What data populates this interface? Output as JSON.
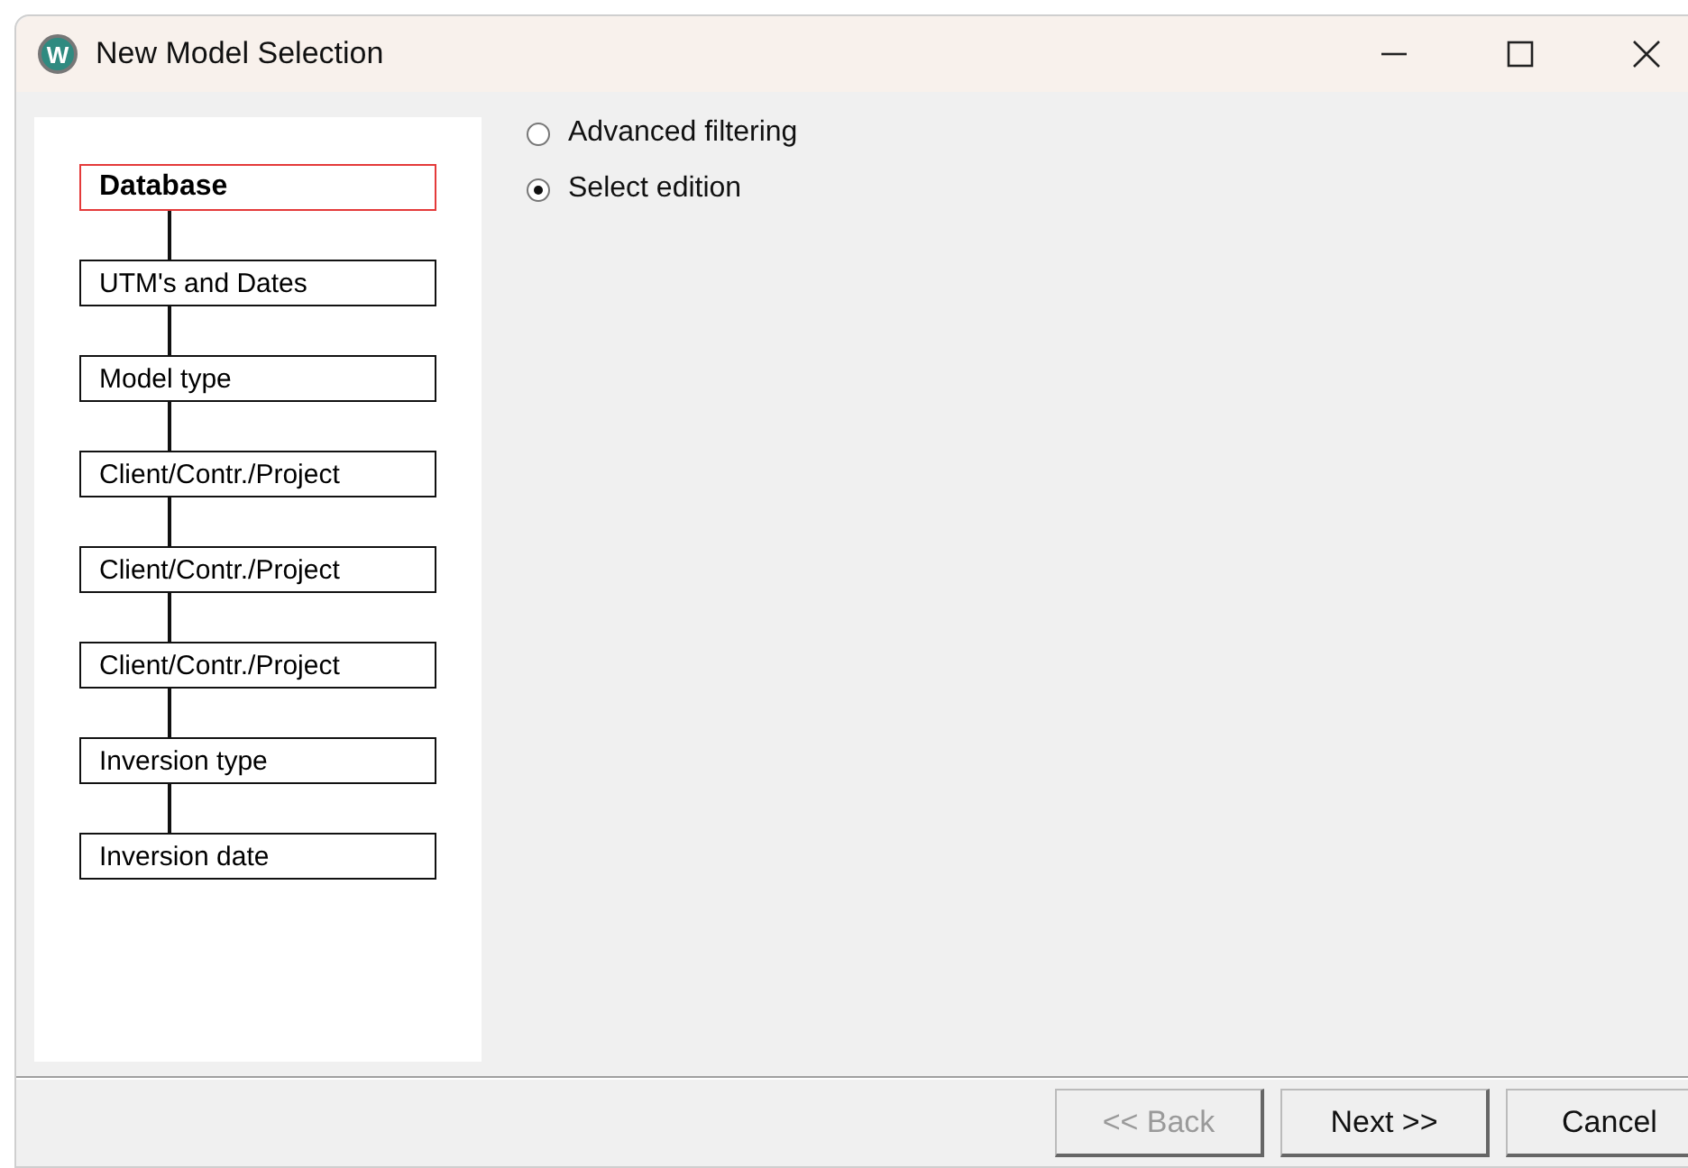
{
  "window": {
    "title": "New Model Selection",
    "logo_letter": "W"
  },
  "steps": [
    {
      "label": "Database",
      "selected": true
    },
    {
      "label": "UTM's and Dates",
      "selected": false
    },
    {
      "label": "Model type",
      "selected": false
    },
    {
      "label": "Client/Contr./Project",
      "selected": false
    },
    {
      "label": "Client/Contr./Project",
      "selected": false
    },
    {
      "label": "Client/Contr./Project",
      "selected": false
    },
    {
      "label": "Inversion type",
      "selected": false
    },
    {
      "label": "Inversion date",
      "selected": false
    }
  ],
  "options": [
    {
      "label": "Advanced filtering",
      "selected": false
    },
    {
      "label": "Select edition",
      "selected": true
    }
  ],
  "buttons": [
    {
      "label": "<< Back",
      "disabled": true
    },
    {
      "label": "Next >>",
      "disabled": false
    },
    {
      "label": "Cancel",
      "disabled": false
    }
  ]
}
